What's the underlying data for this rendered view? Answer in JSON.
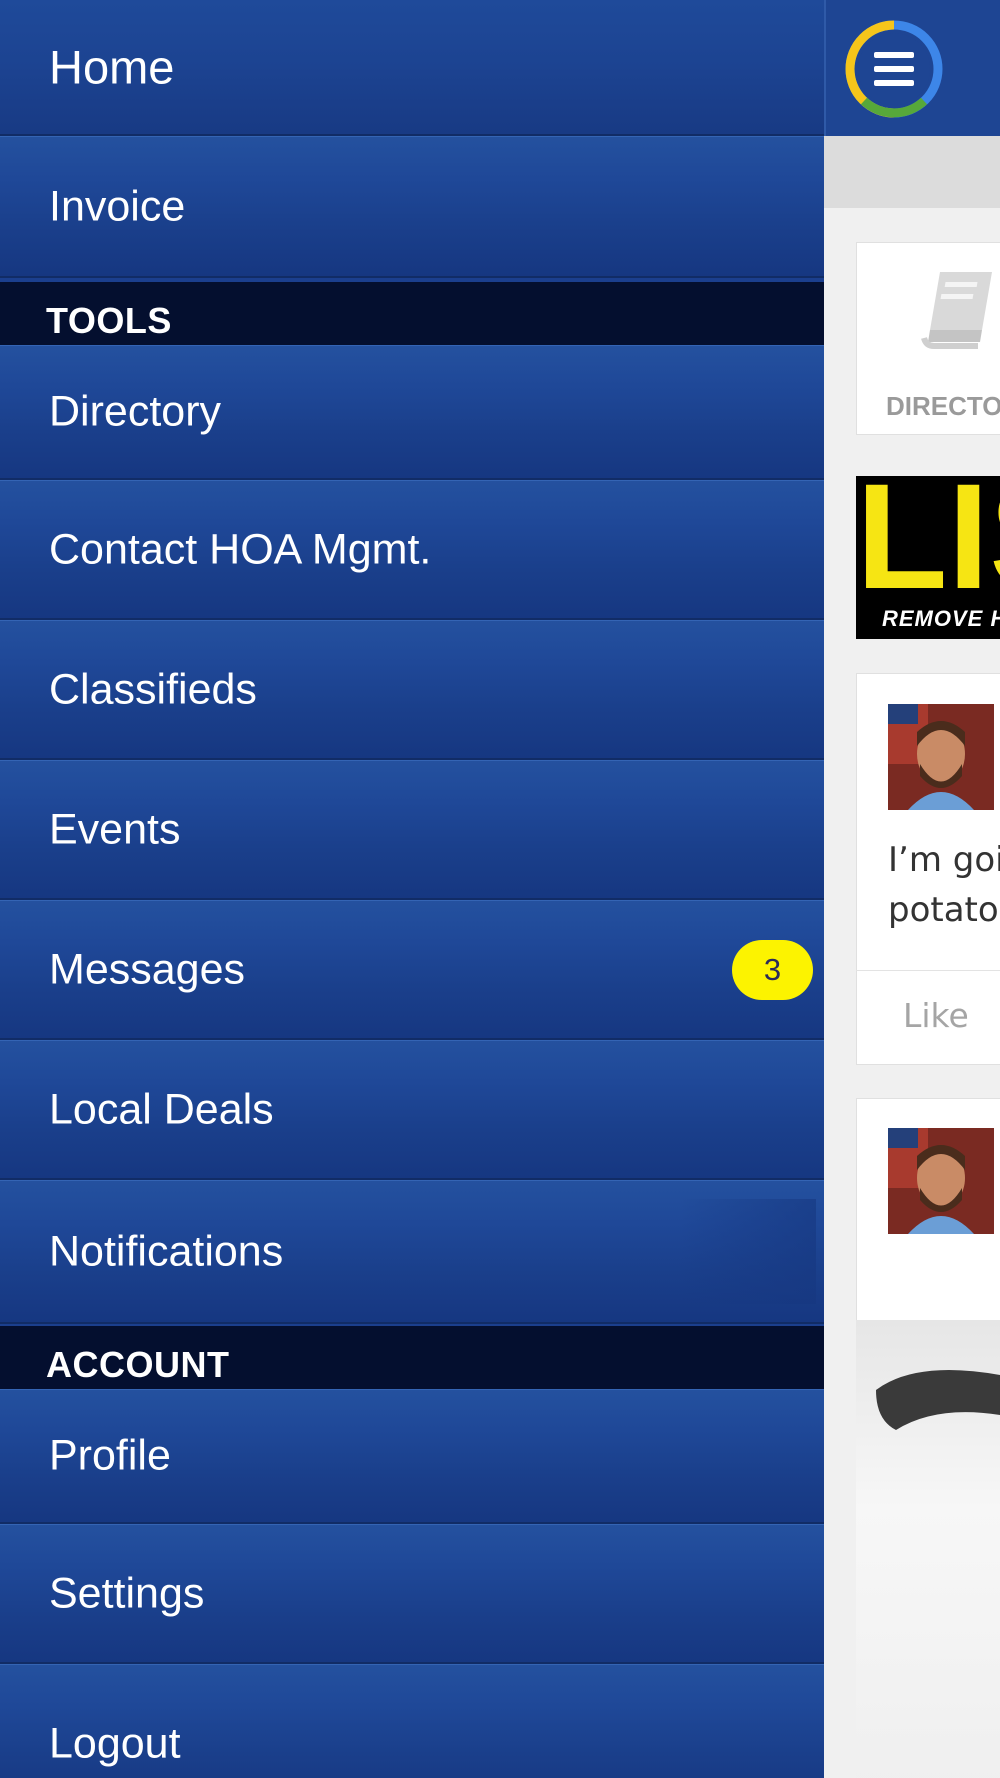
{
  "drawer": {
    "home": "Home",
    "invoice": "Invoice",
    "sections": {
      "tools": "TOOLS",
      "account": "ACCOUNT"
    },
    "tools_items": {
      "directory": "Directory",
      "contact": "Contact HOA Mgmt.",
      "classifieds": "Classifieds",
      "events": "Events",
      "messages": "Messages",
      "messages_badge": "3",
      "local_deals": "Local Deals",
      "notifications": "Notifications"
    },
    "account_items": {
      "profile": "Profile",
      "settings": "Settings",
      "logout": "Logout"
    }
  },
  "content": {
    "directory_tile_label": "DIRECTO",
    "ad_headline": "LIS",
    "ad_subtext": "REMOVE H",
    "post1_line1": "I’m goi",
    "post1_line2": "potato",
    "like_label": "Like"
  },
  "colors": {
    "drawer_blue": "#1b3f8e",
    "section_header": "#040f2f",
    "badge_yellow": "#fcf300",
    "accent_gold": "#f2c418"
  },
  "icons": [
    "hamburger-menu-icon",
    "book-icon"
  ]
}
